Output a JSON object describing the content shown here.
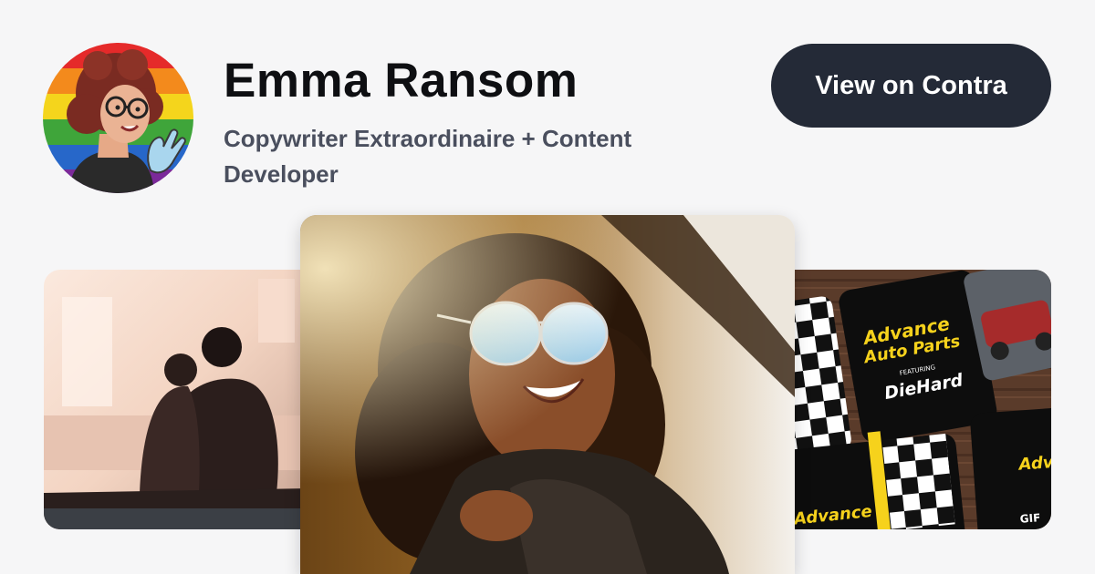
{
  "profile": {
    "name": "Emma Ransom",
    "tagline": "Copywriter Extraordinaire + Content Developer",
    "avatar_icon": "cartoon-avatar"
  },
  "cta": {
    "label": "View on Contra"
  },
  "gallery": {
    "right_image": {
      "brand_line1": "Advance",
      "brand_line2": "Auto Parts",
      "featuring": "FEATURING",
      "product": "DieHard",
      "corner_text": "GIF"
    }
  },
  "colors": {
    "background": "#f6f6f7",
    "button": "#242a37",
    "name": "#0e0f12",
    "tagline": "#4a4f5e",
    "brand_yellow": "#f6d21c"
  }
}
